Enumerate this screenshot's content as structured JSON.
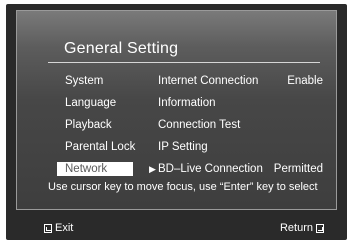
{
  "header": {
    "title": "General Setting"
  },
  "menu": {
    "items": [
      {
        "label": "System"
      },
      {
        "label": "Language"
      },
      {
        "label": "Playback"
      },
      {
        "label": "Parental Lock"
      },
      {
        "label": "Network",
        "selected": true
      }
    ]
  },
  "options": {
    "rows": [
      {
        "label": "Internet Connection",
        "value": "Enable"
      },
      {
        "label": "Information",
        "value": ""
      },
      {
        "label": "Connection Test",
        "value": ""
      },
      {
        "label": "IP Setting",
        "value": ""
      },
      {
        "label": "BD–Live Connection",
        "value": "Permitted",
        "focused": true
      }
    ]
  },
  "hint": {
    "text": "Use cursor key to move focus, use “Enter” key to select"
  },
  "footer": {
    "exit_label": "Exit",
    "return_label": "Return"
  },
  "icons": {
    "focus_arrow": "play-arrow-icon",
    "exit_key": "exit-key-icon",
    "return_key": "return-key-icon"
  },
  "colors": {
    "panel_top": "#7a7a7a",
    "panel_bottom": "#3e3e3e",
    "frame": "#2a2a2a",
    "text": "#ffffff",
    "selected_bg": "#ffffff",
    "selected_text": "#5a5a5a"
  }
}
